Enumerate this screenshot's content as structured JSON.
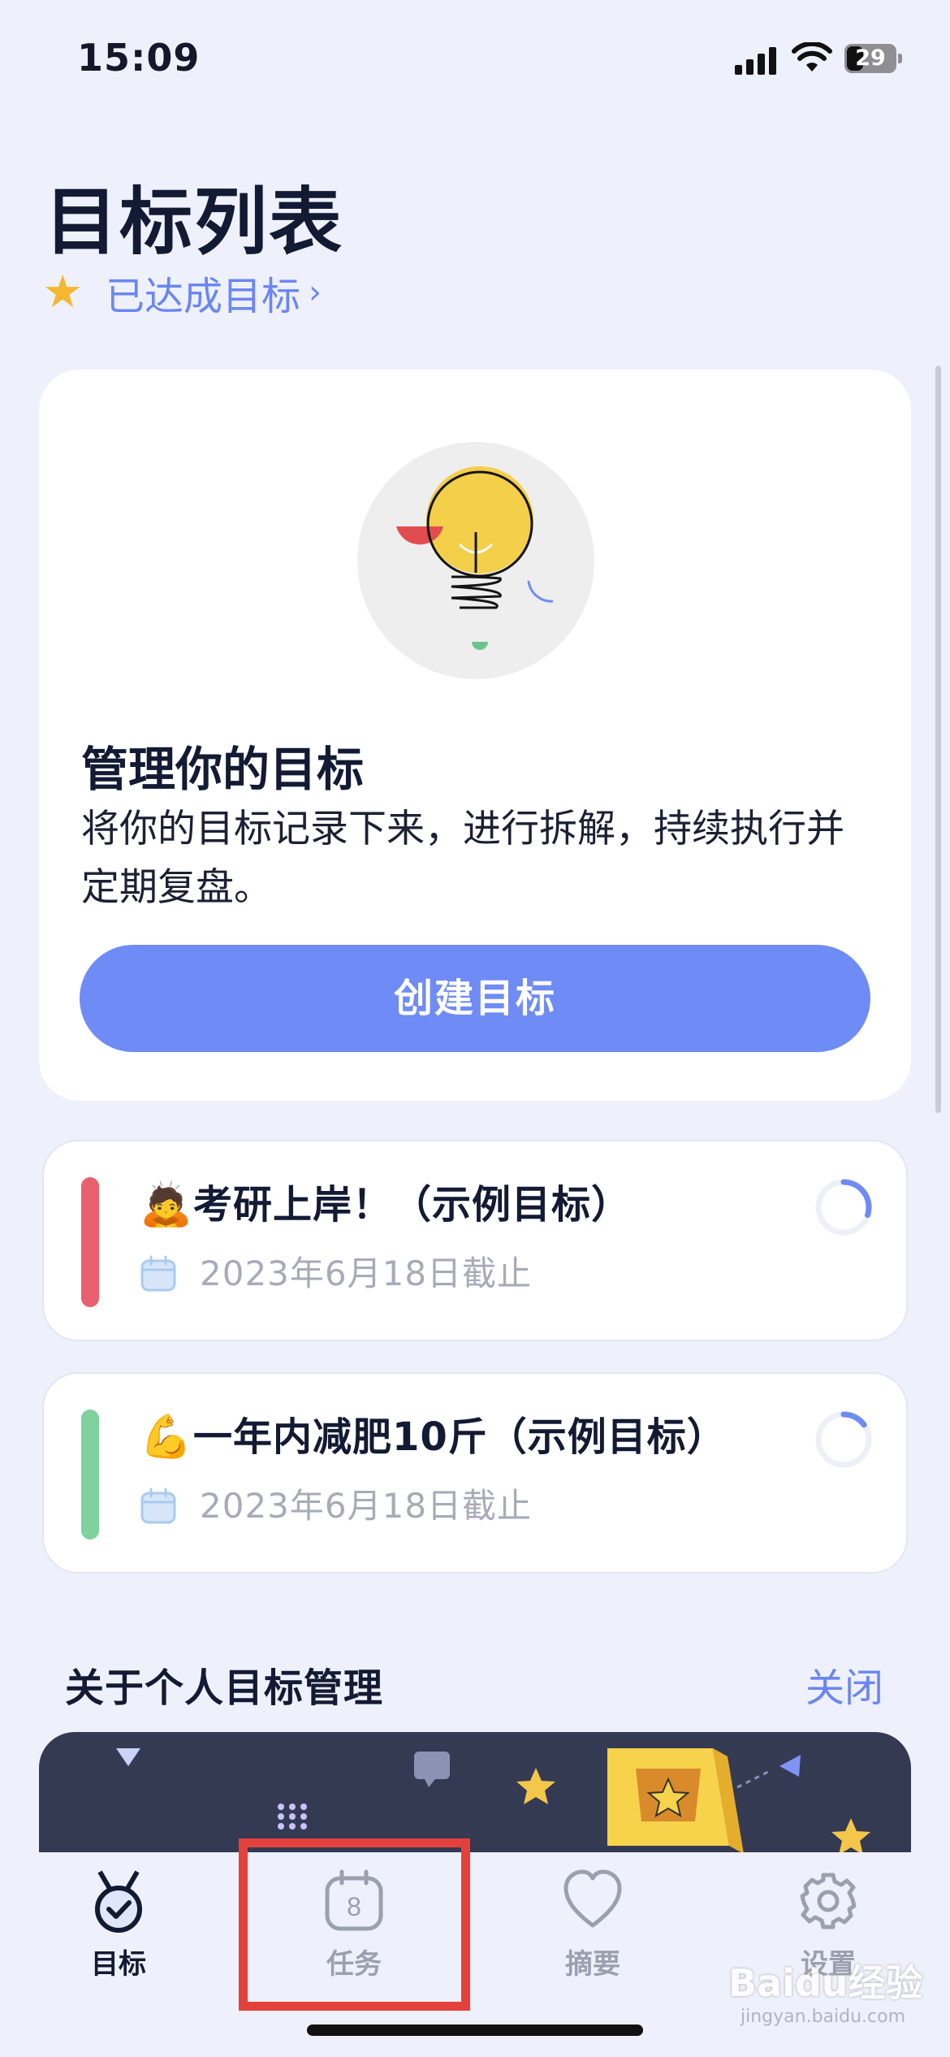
{
  "status_bar": {
    "time": "15:09",
    "battery": "29"
  },
  "header": {
    "title": "目标列表",
    "achieved_label": "已达成目标",
    "achieved_chevron": "›"
  },
  "intro_card": {
    "title": "管理你的目标",
    "description": "将你的目标记录下来，进行拆解，持续执行并定期复盘。",
    "button_label": "创建目标"
  },
  "goals": [
    {
      "emoji": "🙇",
      "title": "考研上岸！（示例目标）",
      "deadline": "2023年6月18日截止",
      "color": "#e8606e",
      "progress": 0.3
    },
    {
      "emoji": "💪",
      "title": "一年内减肥10斤（示例目标）",
      "deadline": "2023年6月18日截止",
      "color": "#7fd19e",
      "progress": 0.15
    }
  ],
  "about": {
    "title": "关于个人目标管理",
    "close_label": "关闭"
  },
  "tabs": [
    {
      "label": "目标",
      "icon": "medal-icon",
      "active": true
    },
    {
      "label": "任务",
      "icon": "calendar-icon",
      "badge": "8",
      "active": false
    },
    {
      "label": "摘要",
      "icon": "heart-icon",
      "active": false
    },
    {
      "label": "设置",
      "icon": "gear-icon",
      "active": false
    }
  ],
  "colors": {
    "accent": "#6f8bf5",
    "link": "#6b86f2",
    "background": "#eef1fb",
    "highlight": "#e5413c"
  },
  "watermark": {
    "brand": "Baidu经验",
    "url": "jingyan.baidu.com"
  }
}
